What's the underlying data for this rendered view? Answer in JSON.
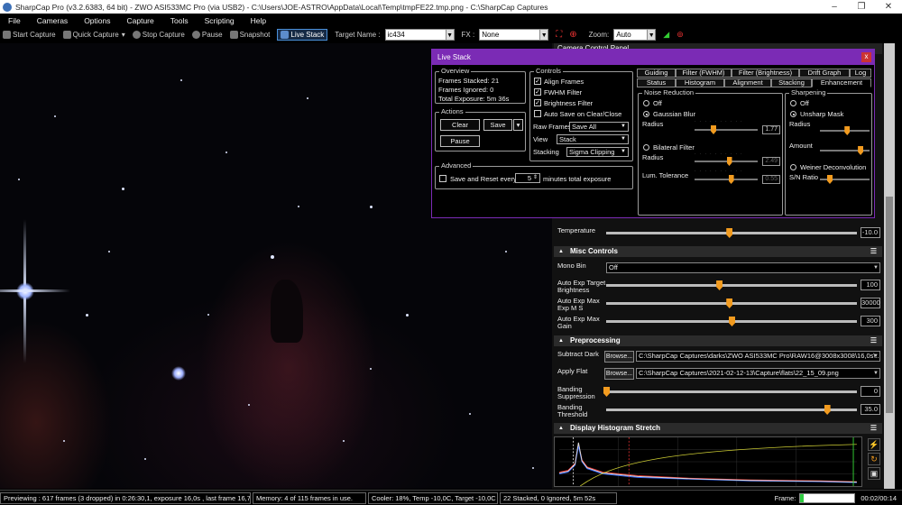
{
  "window": {
    "title": "SharpCap Pro (v3.2.6383, 64 bit) - ZWO ASI533MC Pro (via USB2) - C:\\Users\\JOE-ASTRO\\AppData\\Local\\Temp\\tmpFE22.tmp.png - C:\\SharpCap Captures"
  },
  "menu": [
    "File",
    "Cameras",
    "Options",
    "Capture",
    "Tools",
    "Scripting",
    "Help"
  ],
  "toolbar": {
    "start_capture": "Start Capture",
    "quick_capture": "Quick Capture",
    "stop_capture": "Stop Capture",
    "pause": "Pause",
    "snapshot": "Snapshot",
    "live_stack": "Live Stack",
    "target_label": "Target Name :",
    "target_value": "ic434",
    "fx_label": "FX :",
    "fx_value": "None",
    "zoom_label": "Zoom:",
    "zoom_value": "Auto"
  },
  "camera_panel": {
    "header": "Camera Control Panel",
    "temperature_label": "Temperature",
    "temperature_value": "-10.0",
    "temperature_level": 0.49,
    "misc": {
      "title": "Misc Controls",
      "mono_bin_label": "Mono Bin",
      "mono_bin_value": "Off",
      "rows": [
        {
          "label": "Auto Exp Target Brightness",
          "value": "100",
          "level": 0.45
        },
        {
          "label": "Auto Exp Max Exp M S",
          "value": "30000",
          "level": 0.49
        },
        {
          "label": "Auto Exp Max Gain",
          "value": "300",
          "level": 0.5
        }
      ]
    },
    "preprocessing": {
      "title": "Preprocessing",
      "subtract_dark_label": "Subtract Dark",
      "subtract_dark_value": "C:\\SharpCap Captures\\darks\\ZWO ASI533MC Pro\\RAW16@3008x3008\\16,0s\\...",
      "apply_flat_label": "Apply Flat",
      "apply_flat_value": "C:\\SharpCap Captures\\2021-02-12-13\\Capture\\flats\\22_15_09.png",
      "browse_label": "Browse...",
      "banding_suppression_label": "Banding Suppression",
      "banding_suppression_value": "0",
      "banding_suppression_level": 0.0,
      "banding_threshold_label": "Banding Threshold",
      "banding_threshold_value": "35.0",
      "banding_threshold_level": 0.88
    },
    "histogram": {
      "title": "Display Histogram Stretch"
    }
  },
  "live_stack": {
    "title": "Live Stack",
    "close_label": "x",
    "overview": {
      "title": "Overview",
      "frames_stacked": "Frames Stacked: 21",
      "frames_ignored": "Frames Ignored:  0",
      "total_exposure": "Total Exposure:   5m 36s"
    },
    "actions": {
      "title": "Actions",
      "clear": "Clear",
      "save": "Save",
      "pause": "Pause"
    },
    "controls": {
      "title": "Controls",
      "align_frames": "Align Frames",
      "fwhm_filter": "FWHM Filter",
      "brightness_filter": "Brightness Filter",
      "auto_save": "Auto Save on Clear/Close",
      "raw_frames_label": "Raw Frames",
      "raw_frames_value": "Save All",
      "view_label": "View",
      "view_value": "Stack",
      "stacking_label": "Stacking",
      "stacking_value": "Sigma Clipping"
    },
    "advanced": {
      "title": "Advanced",
      "save_reset_label": "Save and Reset every",
      "minutes_value": "5",
      "minutes_label": "minutes total exposure"
    },
    "tabs_row1": [
      "Guiding",
      "Filter (FWHM)",
      "Filter (Brightness)",
      "Drift Graph",
      "Log"
    ],
    "tabs_row2": [
      "Status",
      "Histogram",
      "Alignment",
      "Stacking",
      "Enhancement"
    ],
    "active_tab": "Enhancement",
    "noise_reduction": {
      "title": "Noise Reduction",
      "off": "Off",
      "gaussian_blur": "Gaussian Blur",
      "radius_label": "Radius",
      "gaussian_radius_value": "1.77",
      "gaussian_radius_level": 0.3,
      "bilateral_filter": "Bilateral Filter",
      "bilateral_radius_value": "2.49",
      "bilateral_radius_level": 0.55,
      "lum_tolerance_label": "Lum. Tolerance",
      "lum_tolerance_value": "0.55",
      "lum_tolerance_level": 0.58
    },
    "sharpening": {
      "title": "Sharpening",
      "off": "Off",
      "unsharp_mask": "Unsharp Mask",
      "radius_label": "Radius",
      "amount_label": "Amount",
      "weiner": "Weiner Deconvolution",
      "sn_ratio_label": "S/N Ratio",
      "radius_level": 0.55,
      "amount_level": 0.82,
      "sn_level": 0.2
    }
  },
  "status": {
    "previewing": "Previewing : 617 frames (3 dropped) in 0:26:30,1, exposure 16,0s , last frame 16,7s",
    "memory": "Memory: 4 of 115 frames in use.",
    "cooler": "Cooler: 18%, Temp -10,0C, Target -10,0C",
    "stack": "22 Stacked, 0 Ignored, 5m 52s",
    "frame_label": "Frame:",
    "frame_progress": 0.06,
    "frame_time": "00:02/00:14"
  },
  "colors": {
    "accent_orange": "#f29b1f",
    "live_stack_purple": "#7b2bb5",
    "frame_progress_green": "#2ecc40"
  }
}
